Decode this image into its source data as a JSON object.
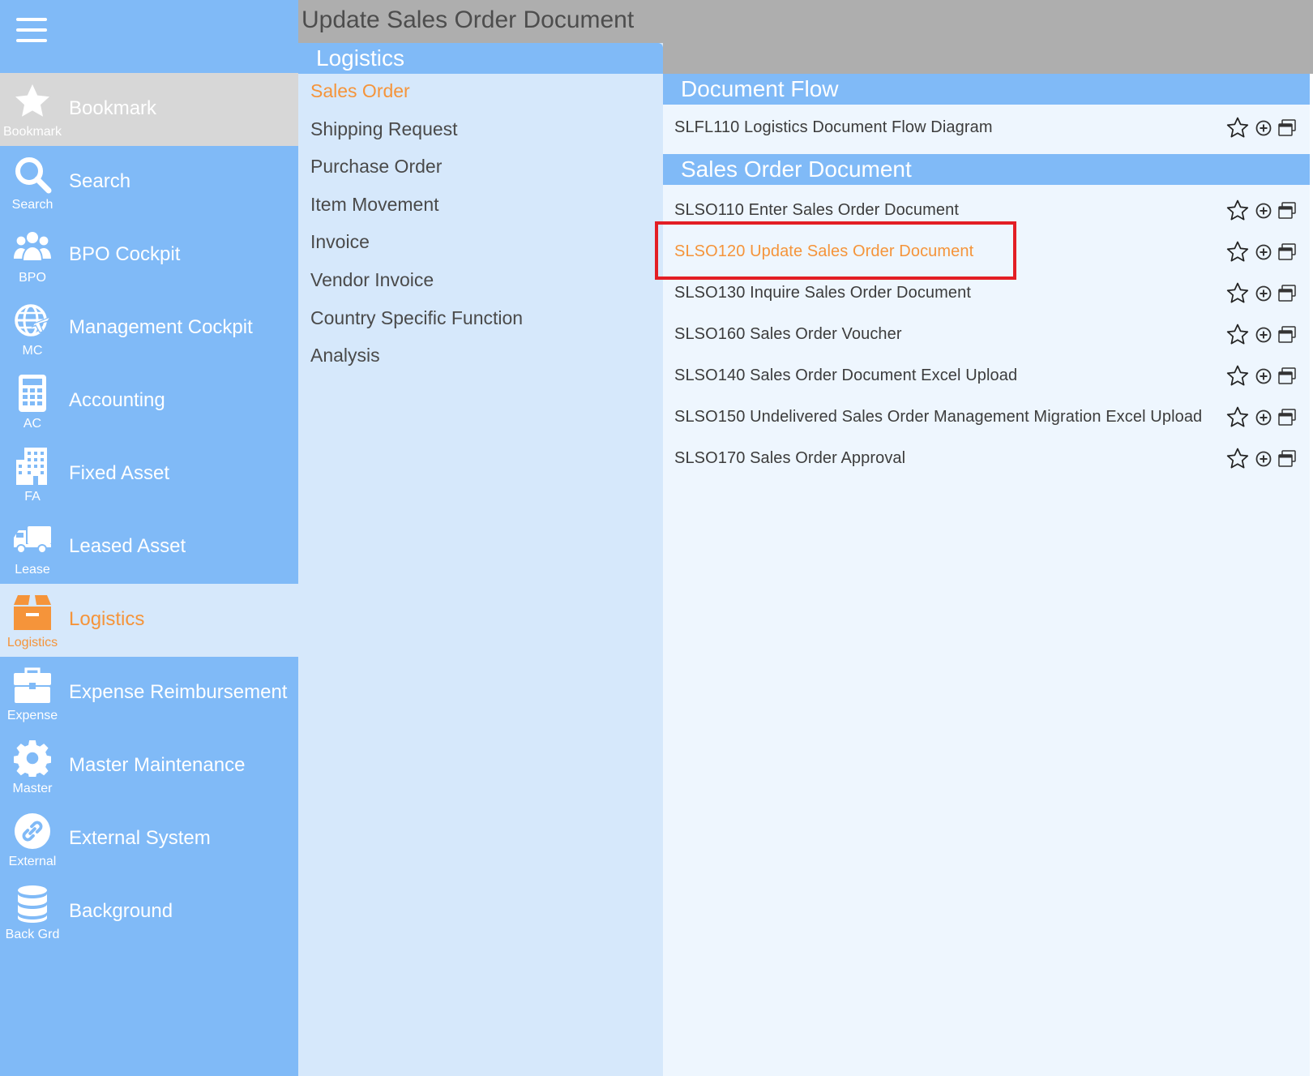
{
  "window": {
    "title": "Update Sales Order Document"
  },
  "sidebar": {
    "items": [
      {
        "key": "bookmark",
        "icon": "star-icon",
        "label": "Bookmark",
        "abbr": "Bookmark"
      },
      {
        "key": "search",
        "icon": "search-icon",
        "label": "Search",
        "abbr": "Search"
      },
      {
        "key": "bpo",
        "icon": "users-icon",
        "label": "BPO Cockpit",
        "abbr": "BPO"
      },
      {
        "key": "mc",
        "icon": "globe-plane-icon",
        "label": "Management Cockpit",
        "abbr": "MC"
      },
      {
        "key": "ac",
        "icon": "calculator-icon",
        "label": "Accounting",
        "abbr": "AC"
      },
      {
        "key": "fa",
        "icon": "building-icon",
        "label": "Fixed Asset",
        "abbr": "FA"
      },
      {
        "key": "lease",
        "icon": "truck-icon",
        "label": "Leased Asset",
        "abbr": "Lease"
      },
      {
        "key": "logistics",
        "icon": "box-icon",
        "label": "Logistics",
        "abbr": "Logistics"
      },
      {
        "key": "expense",
        "icon": "briefcase-icon",
        "label": "Expense Reimbursement",
        "abbr": "Expense"
      },
      {
        "key": "master",
        "icon": "gear-icon",
        "label": "Master Maintenance",
        "abbr": "Master"
      },
      {
        "key": "external",
        "icon": "link-icon",
        "label": "External System",
        "abbr": "External"
      },
      {
        "key": "background",
        "icon": "database-icon",
        "label": "Background",
        "abbr": "Back Grd"
      }
    ]
  },
  "middle": {
    "title": "Logistics",
    "items": [
      "Sales Order",
      "Shipping Request",
      "Purchase Order",
      "Item Movement",
      "Invoice",
      "Vendor Invoice",
      "Country Specific Function",
      "Analysis"
    ]
  },
  "sections": [
    {
      "title": "Document Flow",
      "rows": [
        "SLFL110 Logistics Document Flow Diagram"
      ]
    },
    {
      "title": "Sales Order Document",
      "rows": [
        "SLSO110 Enter Sales Order Document",
        "SLSO120 Update Sales Order Document",
        "SLSO130 Inquire Sales Order Document",
        "SLSO160 Sales Order Voucher",
        "SLSO140 Sales Order Document Excel Upload",
        "SLSO150 Undelivered Sales Order Management Migration Excel Upload",
        "SLSO170 Sales Order Approval"
      ]
    }
  ],
  "colors": {
    "accent_orange": "#f5943a",
    "sidebar_blue": "#80baf7",
    "highlight_red": "#e31e24"
  }
}
